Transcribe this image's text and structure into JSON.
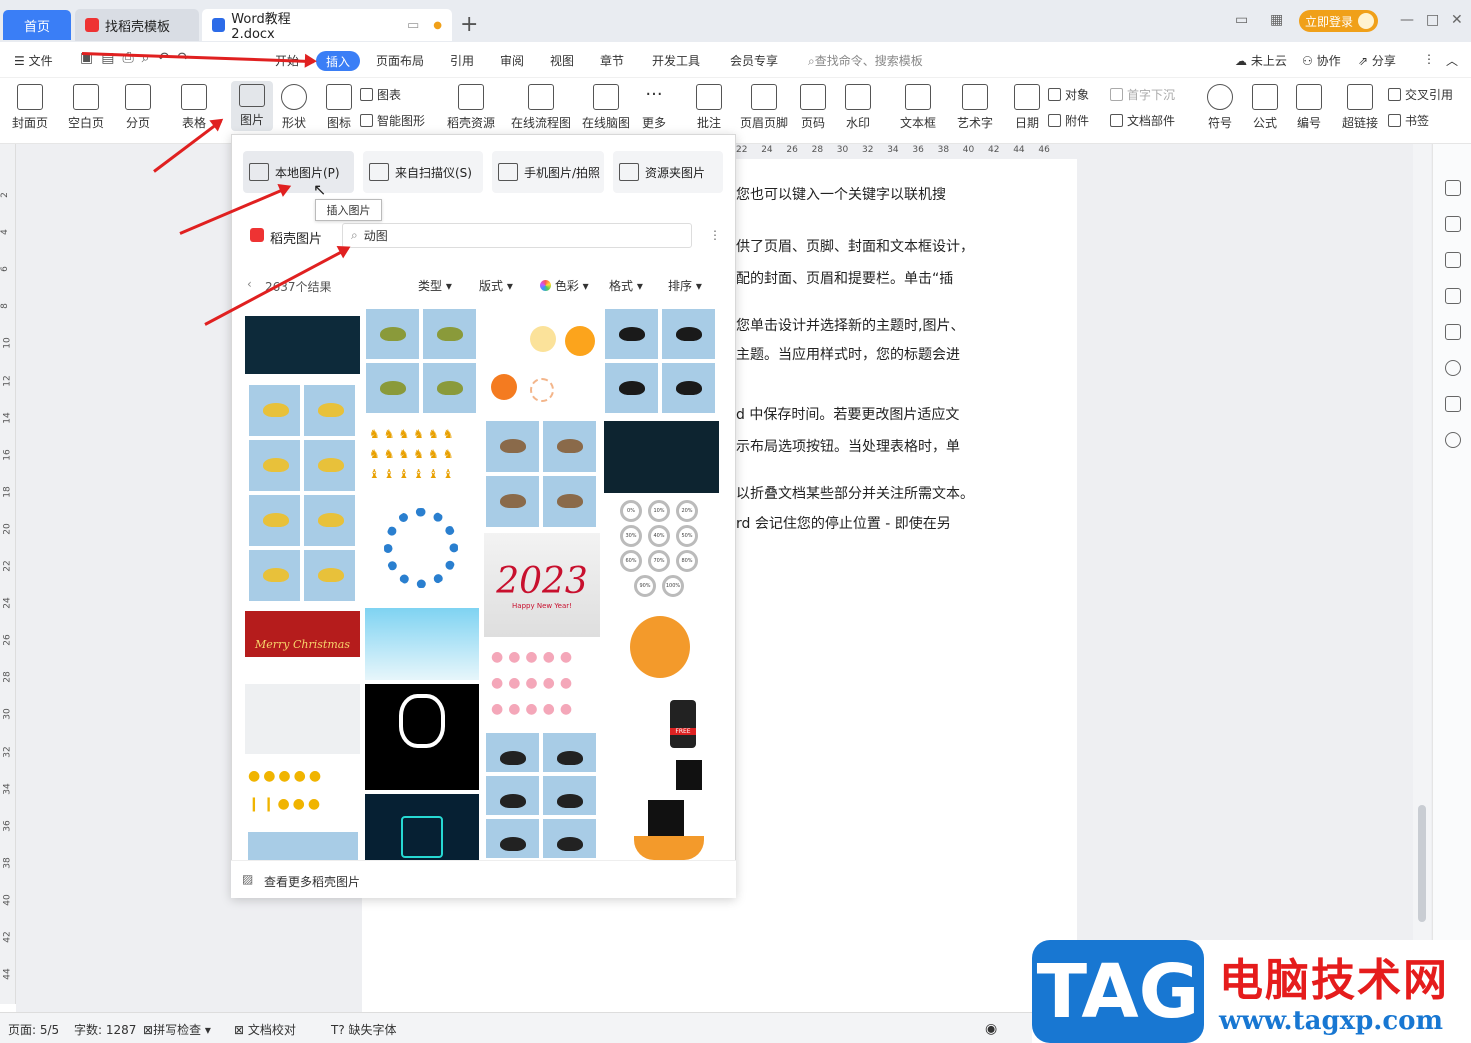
{
  "titlebar": {
    "tabs": [
      {
        "label": "首页"
      },
      {
        "label": "找稻壳模板"
      },
      {
        "label": "Word教程2.docx"
      }
    ],
    "login_label": "立即登录"
  },
  "menubar": {
    "file_label": "文件",
    "items": [
      "开始",
      "插入",
      "页面布局",
      "引用",
      "审阅",
      "视图",
      "章节",
      "开发工具",
      "会员专享"
    ],
    "search_placeholder": "查找命令、搜索模板",
    "cloud_label": "未上云",
    "collab_label": "协作",
    "share_label": "分享"
  },
  "ribbon": {
    "buttons": [
      {
        "label": "封面页"
      },
      {
        "label": "空白页"
      },
      {
        "label": "分页"
      },
      {
        "label": "表格"
      },
      {
        "label": "图片"
      },
      {
        "label": "形状"
      },
      {
        "label": "图标"
      },
      {
        "label": "稻壳资源"
      },
      {
        "label": "在线流程图"
      },
      {
        "label": "在线脑图"
      },
      {
        "label": "更多"
      },
      {
        "label": "批注"
      },
      {
        "label": "页眉页脚"
      },
      {
        "label": "页码"
      },
      {
        "label": "水印"
      },
      {
        "label": "文本框"
      },
      {
        "label": "艺术字"
      },
      {
        "label": "日期"
      },
      {
        "label": "符号"
      },
      {
        "label": "公式"
      },
      {
        "label": "编号"
      },
      {
        "label": "超链接"
      }
    ],
    "small": {
      "chart": "图表",
      "smart": "智能图形",
      "object": "对象",
      "dropcap": "首字下沉",
      "attach": "附件",
      "docpart": "文档部件",
      "crossref": "交叉引用",
      "bookmark": "书签"
    }
  },
  "ruler_top": [
    "22",
    "24",
    "26",
    "28",
    "30",
    "32",
    "34",
    "36",
    "38",
    "40",
    "42",
    "44",
    "46"
  ],
  "ruler_left": [
    "2",
    "4",
    "6",
    "8",
    "10",
    "12",
    "14",
    "16",
    "18",
    "20",
    "22",
    "24",
    "26",
    "28",
    "30",
    "32",
    "34",
    "36",
    "38",
    "40",
    "42",
    "44"
  ],
  "document": {
    "lines": [
      "您也可以键入一个关键字以联机搜",
      "供了页眉、页脚、封面和文本框设计，",
      "配的封面、页眉和提要栏。单击“插",
      "您单击设计并选择新的主题时,图片、",
      "主题。当应用样式时，您的标题会进",
      "d 中保存时间。若要更改图片适应文",
      "示布局选项按钮。当处理表格时，单",
      "以折叠文档某些部分并关注所需文本。",
      "rd 会记住您的停止位置 - 即使在另"
    ]
  },
  "panel": {
    "buttons": [
      {
        "label": "本地图片(P)"
      },
      {
        "label": "来自扫描仪(S)"
      },
      {
        "label": "手机图片/拍照"
      },
      {
        "label": "资源夹图片"
      }
    ],
    "tooltip": "插入图片",
    "brand": "稻壳图片",
    "search_value": "动图",
    "result_count": "2637个结果",
    "filters": [
      "类型",
      "版式",
      "色彩",
      "格式",
      "排序"
    ],
    "thumb_text": {
      "new_year": "2023",
      "new_year_sub": "Happy New Year!",
      "christmas": "Merry Christmas",
      "free": "FREE"
    },
    "percent_labels": [
      "0%",
      "10%",
      "20%",
      "30%",
      "40%",
      "50%",
      "60%",
      "70%",
      "80%",
      "90%",
      "100%"
    ],
    "footer": "查看更多稻壳图片"
  },
  "statusbar": {
    "page": "页面: 5/5",
    "words": "字数: 1287",
    "spell": "拼写检查",
    "proof": "文档校对",
    "font": "缺失字体"
  },
  "watermark": {
    "tag": "TAG",
    "title": "电脑技术网",
    "url": "www.tagxp.com"
  }
}
